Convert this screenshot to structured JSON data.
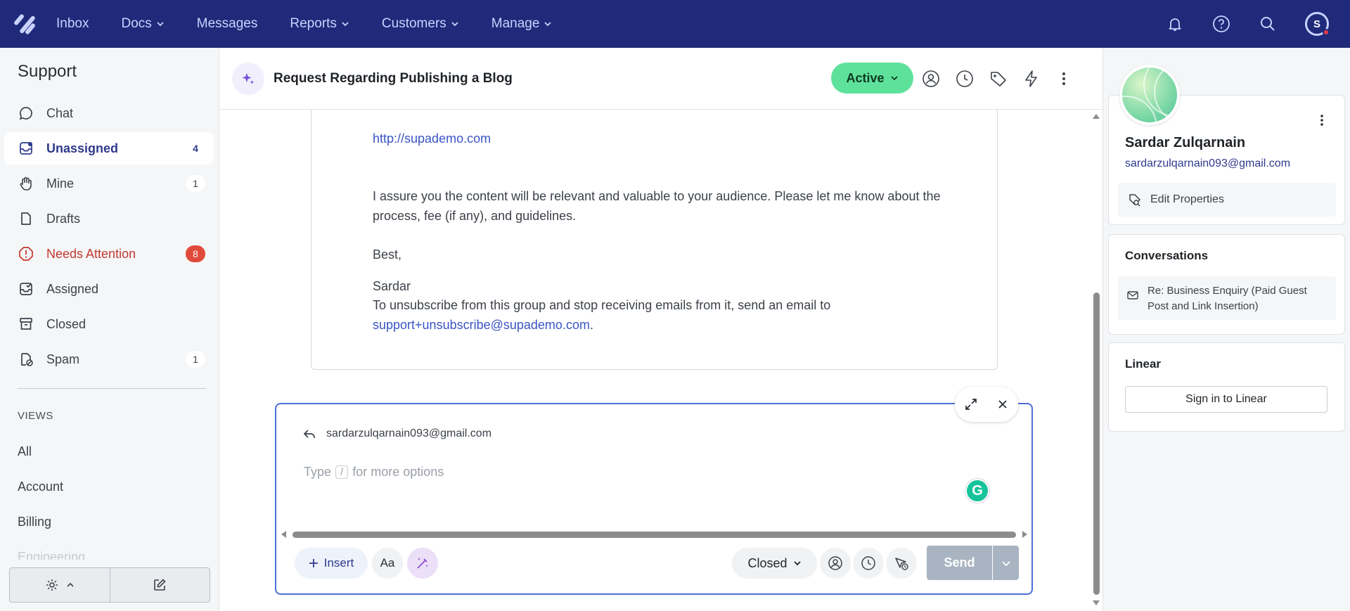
{
  "nav": {
    "items": [
      {
        "label": "Inbox",
        "has_caret": false
      },
      {
        "label": "Docs",
        "has_caret": true
      },
      {
        "label": "Messages",
        "has_caret": false
      },
      {
        "label": "Reports",
        "has_caret": true
      },
      {
        "label": "Customers",
        "has_caret": true
      },
      {
        "label": "Manage",
        "has_caret": true
      }
    ],
    "avatar_initial": "S"
  },
  "sidebar": {
    "title": "Support",
    "items": [
      {
        "label": "Chat",
        "count": "",
        "icon": "chat-icon"
      },
      {
        "label": "Unassigned",
        "count": "4",
        "icon": "unassigned-icon"
      },
      {
        "label": "Mine",
        "count": "1",
        "icon": "hand-icon"
      },
      {
        "label": "Drafts",
        "count": "",
        "icon": "draft-icon"
      },
      {
        "label": "Needs Attention",
        "count": "8",
        "icon": "alert-icon"
      },
      {
        "label": "Assigned",
        "count": "",
        "icon": "assigned-icon"
      },
      {
        "label": "Closed",
        "count": "",
        "icon": "archive-icon"
      },
      {
        "label": "Spam",
        "count": "1",
        "icon": "spam-icon"
      }
    ],
    "views_heading": "VIEWS",
    "views": [
      "All",
      "Account",
      "Billing",
      "Engineering"
    ]
  },
  "conversation": {
    "title": "Request Regarding Publishing a Blog",
    "status": "Active"
  },
  "message": {
    "link": "http://supademo.com",
    "paragraph_line1": "I assure you the content will be relevant and valuable to your audience. Please let me know about the",
    "paragraph_line2": "process, fee (if any), and guidelines.",
    "closing": "Best,",
    "signature": "Sardar",
    "unsubscribe_text": "To unsubscribe from this group and stop receiving emails from it, send an email to",
    "unsubscribe_email": "support+unsubscribe@supademo.com",
    "unsubscribe_end": "."
  },
  "composer": {
    "reply_to": "sardarzulqarnain093@gmail.com",
    "placeholder_before": "Type",
    "placeholder_key": "/",
    "placeholder_after": "for more options",
    "insert_label": "Insert",
    "font_label": "Aa",
    "status_label": "Closed",
    "send_label": "Send",
    "grammarly_letter": "G"
  },
  "profile": {
    "name": "Sardar Zulqarnain",
    "email": "sardarzulqarnain093@gmail.com",
    "edit_label": "Edit Properties"
  },
  "conversations_card": {
    "title": "Conversations",
    "item": "Re: Business Enquiry (Paid Guest Post and Link Insertion)"
  },
  "linear_card": {
    "title": "Linear",
    "button": "Sign in to Linear"
  },
  "colors": {
    "nav_bg": "#1f2a7a",
    "active_status": "#5ee29b",
    "accent": "#2e3a8c",
    "attention": "#e04a3a"
  }
}
